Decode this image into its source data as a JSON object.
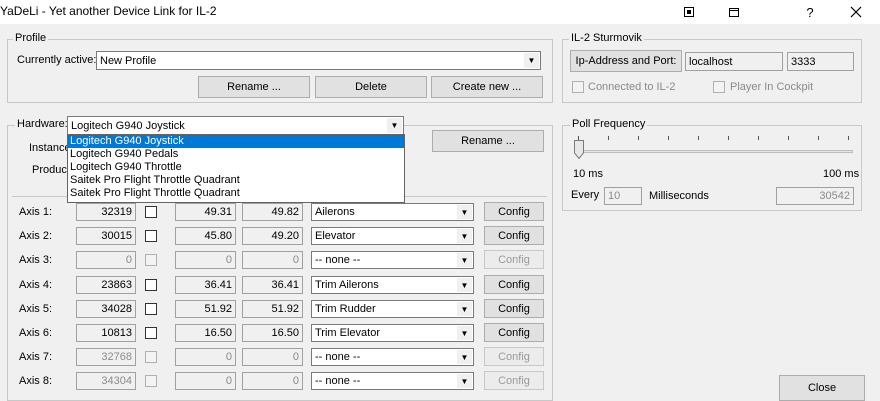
{
  "window": {
    "title": "YaDeLi - Yet another Device Link for IL-2",
    "help_label": "?"
  },
  "profile": {
    "legend": "Profile",
    "currently_active_label": "Currently active:",
    "current_value": "New Profile",
    "rename_label": "Rename ...",
    "delete_label": "Delete",
    "create_new_label": "Create new ..."
  },
  "il2": {
    "legend": "IL-2 Sturmovik",
    "ip_button_label": "Ip-Address and Port:",
    "host": "localhost",
    "port": "3333",
    "connected_label": "Connected to IL-2",
    "player_label": "Player In Cockpit"
  },
  "hardware": {
    "legend": "Hardware:",
    "selected": "Logitech G940 Joystick",
    "instance_label": "Instance",
    "product_label": "Product",
    "rename_label": "Rename ...",
    "dropdown_options": [
      "Logitech G940 Joystick",
      "Logitech G940 Pedals",
      "Logitech G940 Throttle",
      "Saitek Pro Flight Throttle Quadrant",
      "Saitek Pro Flight Throttle Quadrant"
    ]
  },
  "axes": [
    {
      "label": "Axis 1:",
      "raw": "32319",
      "v1": "49.31",
      "v2": "49.82",
      "assign": "Ailerons",
      "config": "Config",
      "enabled": true
    },
    {
      "label": "Axis 2:",
      "raw": "30015",
      "v1": "45.80",
      "v2": "49.20",
      "assign": "Elevator",
      "config": "Config",
      "enabled": true
    },
    {
      "label": "Axis 3:",
      "raw": "0",
      "v1": "0",
      "v2": "0",
      "assign": "-- none --",
      "config": "Config",
      "enabled": false
    },
    {
      "label": "Axis 4:",
      "raw": "23863",
      "v1": "36.41",
      "v2": "36.41",
      "assign": "Trim Ailerons",
      "config": "Config",
      "enabled": true
    },
    {
      "label": "Axis 5:",
      "raw": "34028",
      "v1": "51.92",
      "v2": "51.92",
      "assign": "Trim Rudder",
      "config": "Config",
      "enabled": true
    },
    {
      "label": "Axis 6:",
      "raw": "10813",
      "v1": "16.50",
      "v2": "16.50",
      "assign": "Trim Elevator",
      "config": "Config",
      "enabled": true
    },
    {
      "label": "Axis 7:",
      "raw": "32768",
      "v1": "0",
      "v2": "0",
      "assign": "-- none --",
      "config": "Config",
      "enabled": false
    },
    {
      "label": "Axis 8:",
      "raw": "34304",
      "v1": "0",
      "v2": "0",
      "assign": "-- none --",
      "config": "Config",
      "enabled": false
    }
  ],
  "poll": {
    "legend": "Poll Frequency",
    "min_label": "10 ms",
    "max_label": "100 ms",
    "slider_value": 0.0,
    "every_label": "Every",
    "every_value": "10",
    "unit_label": "Milliseconds",
    "count": "30542"
  },
  "close_label": "Close"
}
